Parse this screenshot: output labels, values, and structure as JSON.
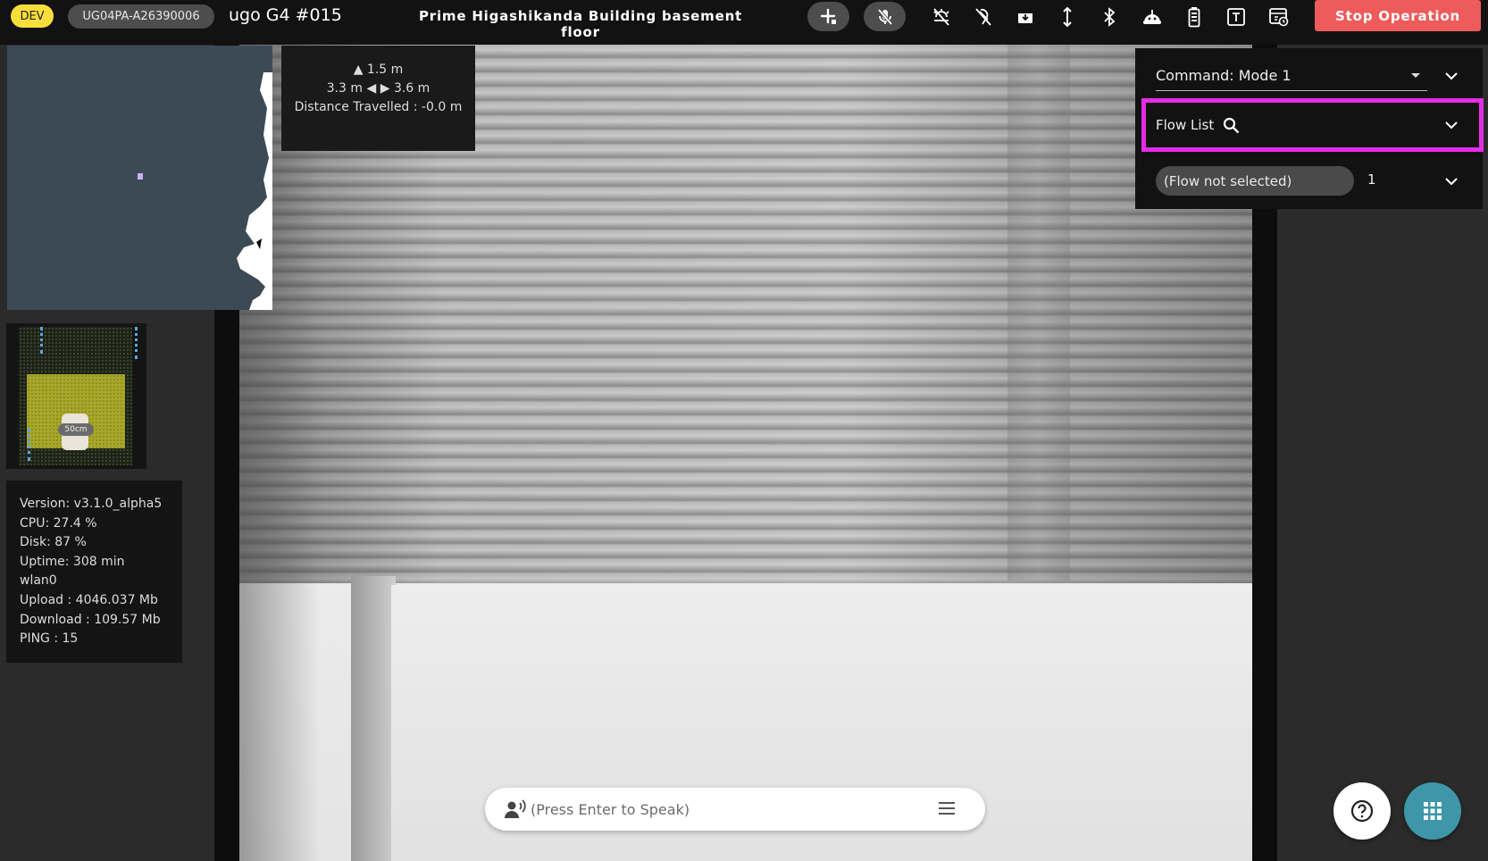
{
  "header": {
    "env_badge": "DEV",
    "serial": "UG04PA-A26390006",
    "robot_name": "ugo G4 #015",
    "location": "Prime Higashikanda Building basement floor",
    "stop_label": "Stop Operation",
    "icons": [
      "add-icon",
      "mic-off-icon",
      "light-off-icon",
      "pointer-off-icon",
      "save-icon",
      "height-icon",
      "bluetooth-icon",
      "robot-icon",
      "battery-icon",
      "text-icon",
      "calendar-icon"
    ]
  },
  "distance": {
    "front": "1.5 m",
    "left": "3.3 m",
    "right": "3.6 m",
    "travelled": "Distance Travelled : -0.0 m"
  },
  "proximity": {
    "scale": "50cm"
  },
  "system": {
    "version": "Version: v3.1.0_alpha5",
    "cpu": "CPU: 27.4 %",
    "disk": "Disk: 87 %",
    "uptime": "Uptime: 308 min",
    "network": "wlan0",
    "upload": "Upload : 4046.037 Mb",
    "download": "Download : 109.57 Mb",
    "ping": "PING : 15"
  },
  "command": {
    "mode": "Command: Mode 1",
    "flow_list_label": "Flow List",
    "flow_selected": "(Flow not selected)",
    "flow_count": "1"
  },
  "speak": {
    "placeholder": "(Press Enter to Speak)"
  },
  "colors": {
    "dev_badge": "#f7de3a",
    "stop": "#ee5b5b",
    "highlight": "#e62ce8",
    "apps_fab": "#3d97a8"
  }
}
